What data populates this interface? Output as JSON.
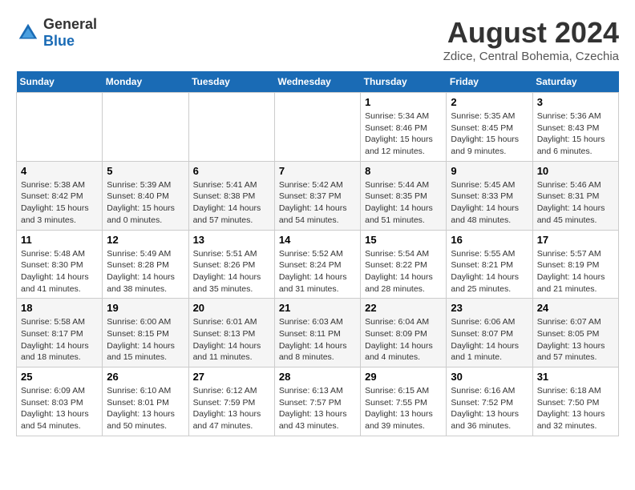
{
  "header": {
    "logo_general": "General",
    "logo_blue": "Blue",
    "month_year": "August 2024",
    "location": "Zdice, Central Bohemia, Czechia"
  },
  "weekdays": [
    "Sunday",
    "Monday",
    "Tuesday",
    "Wednesday",
    "Thursday",
    "Friday",
    "Saturday"
  ],
  "weeks": [
    [
      {
        "day": "",
        "info": ""
      },
      {
        "day": "",
        "info": ""
      },
      {
        "day": "",
        "info": ""
      },
      {
        "day": "",
        "info": ""
      },
      {
        "day": "1",
        "info": "Sunrise: 5:34 AM\nSunset: 8:46 PM\nDaylight: 15 hours\nand 12 minutes."
      },
      {
        "day": "2",
        "info": "Sunrise: 5:35 AM\nSunset: 8:45 PM\nDaylight: 15 hours\nand 9 minutes."
      },
      {
        "day": "3",
        "info": "Sunrise: 5:36 AM\nSunset: 8:43 PM\nDaylight: 15 hours\nand 6 minutes."
      }
    ],
    [
      {
        "day": "4",
        "info": "Sunrise: 5:38 AM\nSunset: 8:42 PM\nDaylight: 15 hours\nand 3 minutes."
      },
      {
        "day": "5",
        "info": "Sunrise: 5:39 AM\nSunset: 8:40 PM\nDaylight: 15 hours\nand 0 minutes."
      },
      {
        "day": "6",
        "info": "Sunrise: 5:41 AM\nSunset: 8:38 PM\nDaylight: 14 hours\nand 57 minutes."
      },
      {
        "day": "7",
        "info": "Sunrise: 5:42 AM\nSunset: 8:37 PM\nDaylight: 14 hours\nand 54 minutes."
      },
      {
        "day": "8",
        "info": "Sunrise: 5:44 AM\nSunset: 8:35 PM\nDaylight: 14 hours\nand 51 minutes."
      },
      {
        "day": "9",
        "info": "Sunrise: 5:45 AM\nSunset: 8:33 PM\nDaylight: 14 hours\nand 48 minutes."
      },
      {
        "day": "10",
        "info": "Sunrise: 5:46 AM\nSunset: 8:31 PM\nDaylight: 14 hours\nand 45 minutes."
      }
    ],
    [
      {
        "day": "11",
        "info": "Sunrise: 5:48 AM\nSunset: 8:30 PM\nDaylight: 14 hours\nand 41 minutes."
      },
      {
        "day": "12",
        "info": "Sunrise: 5:49 AM\nSunset: 8:28 PM\nDaylight: 14 hours\nand 38 minutes."
      },
      {
        "day": "13",
        "info": "Sunrise: 5:51 AM\nSunset: 8:26 PM\nDaylight: 14 hours\nand 35 minutes."
      },
      {
        "day": "14",
        "info": "Sunrise: 5:52 AM\nSunset: 8:24 PM\nDaylight: 14 hours\nand 31 minutes."
      },
      {
        "day": "15",
        "info": "Sunrise: 5:54 AM\nSunset: 8:22 PM\nDaylight: 14 hours\nand 28 minutes."
      },
      {
        "day": "16",
        "info": "Sunrise: 5:55 AM\nSunset: 8:21 PM\nDaylight: 14 hours\nand 25 minutes."
      },
      {
        "day": "17",
        "info": "Sunrise: 5:57 AM\nSunset: 8:19 PM\nDaylight: 14 hours\nand 21 minutes."
      }
    ],
    [
      {
        "day": "18",
        "info": "Sunrise: 5:58 AM\nSunset: 8:17 PM\nDaylight: 14 hours\nand 18 minutes."
      },
      {
        "day": "19",
        "info": "Sunrise: 6:00 AM\nSunset: 8:15 PM\nDaylight: 14 hours\nand 15 minutes."
      },
      {
        "day": "20",
        "info": "Sunrise: 6:01 AM\nSunset: 8:13 PM\nDaylight: 14 hours\nand 11 minutes."
      },
      {
        "day": "21",
        "info": "Sunrise: 6:03 AM\nSunset: 8:11 PM\nDaylight: 14 hours\nand 8 minutes."
      },
      {
        "day": "22",
        "info": "Sunrise: 6:04 AM\nSunset: 8:09 PM\nDaylight: 14 hours\nand 4 minutes."
      },
      {
        "day": "23",
        "info": "Sunrise: 6:06 AM\nSunset: 8:07 PM\nDaylight: 14 hours\nand 1 minute."
      },
      {
        "day": "24",
        "info": "Sunrise: 6:07 AM\nSunset: 8:05 PM\nDaylight: 13 hours\nand 57 minutes."
      }
    ],
    [
      {
        "day": "25",
        "info": "Sunrise: 6:09 AM\nSunset: 8:03 PM\nDaylight: 13 hours\nand 54 minutes."
      },
      {
        "day": "26",
        "info": "Sunrise: 6:10 AM\nSunset: 8:01 PM\nDaylight: 13 hours\nand 50 minutes."
      },
      {
        "day": "27",
        "info": "Sunrise: 6:12 AM\nSunset: 7:59 PM\nDaylight: 13 hours\nand 47 minutes."
      },
      {
        "day": "28",
        "info": "Sunrise: 6:13 AM\nSunset: 7:57 PM\nDaylight: 13 hours\nand 43 minutes."
      },
      {
        "day": "29",
        "info": "Sunrise: 6:15 AM\nSunset: 7:55 PM\nDaylight: 13 hours\nand 39 minutes."
      },
      {
        "day": "30",
        "info": "Sunrise: 6:16 AM\nSunset: 7:52 PM\nDaylight: 13 hours\nand 36 minutes."
      },
      {
        "day": "31",
        "info": "Sunrise: 6:18 AM\nSunset: 7:50 PM\nDaylight: 13 hours\nand 32 minutes."
      }
    ]
  ]
}
